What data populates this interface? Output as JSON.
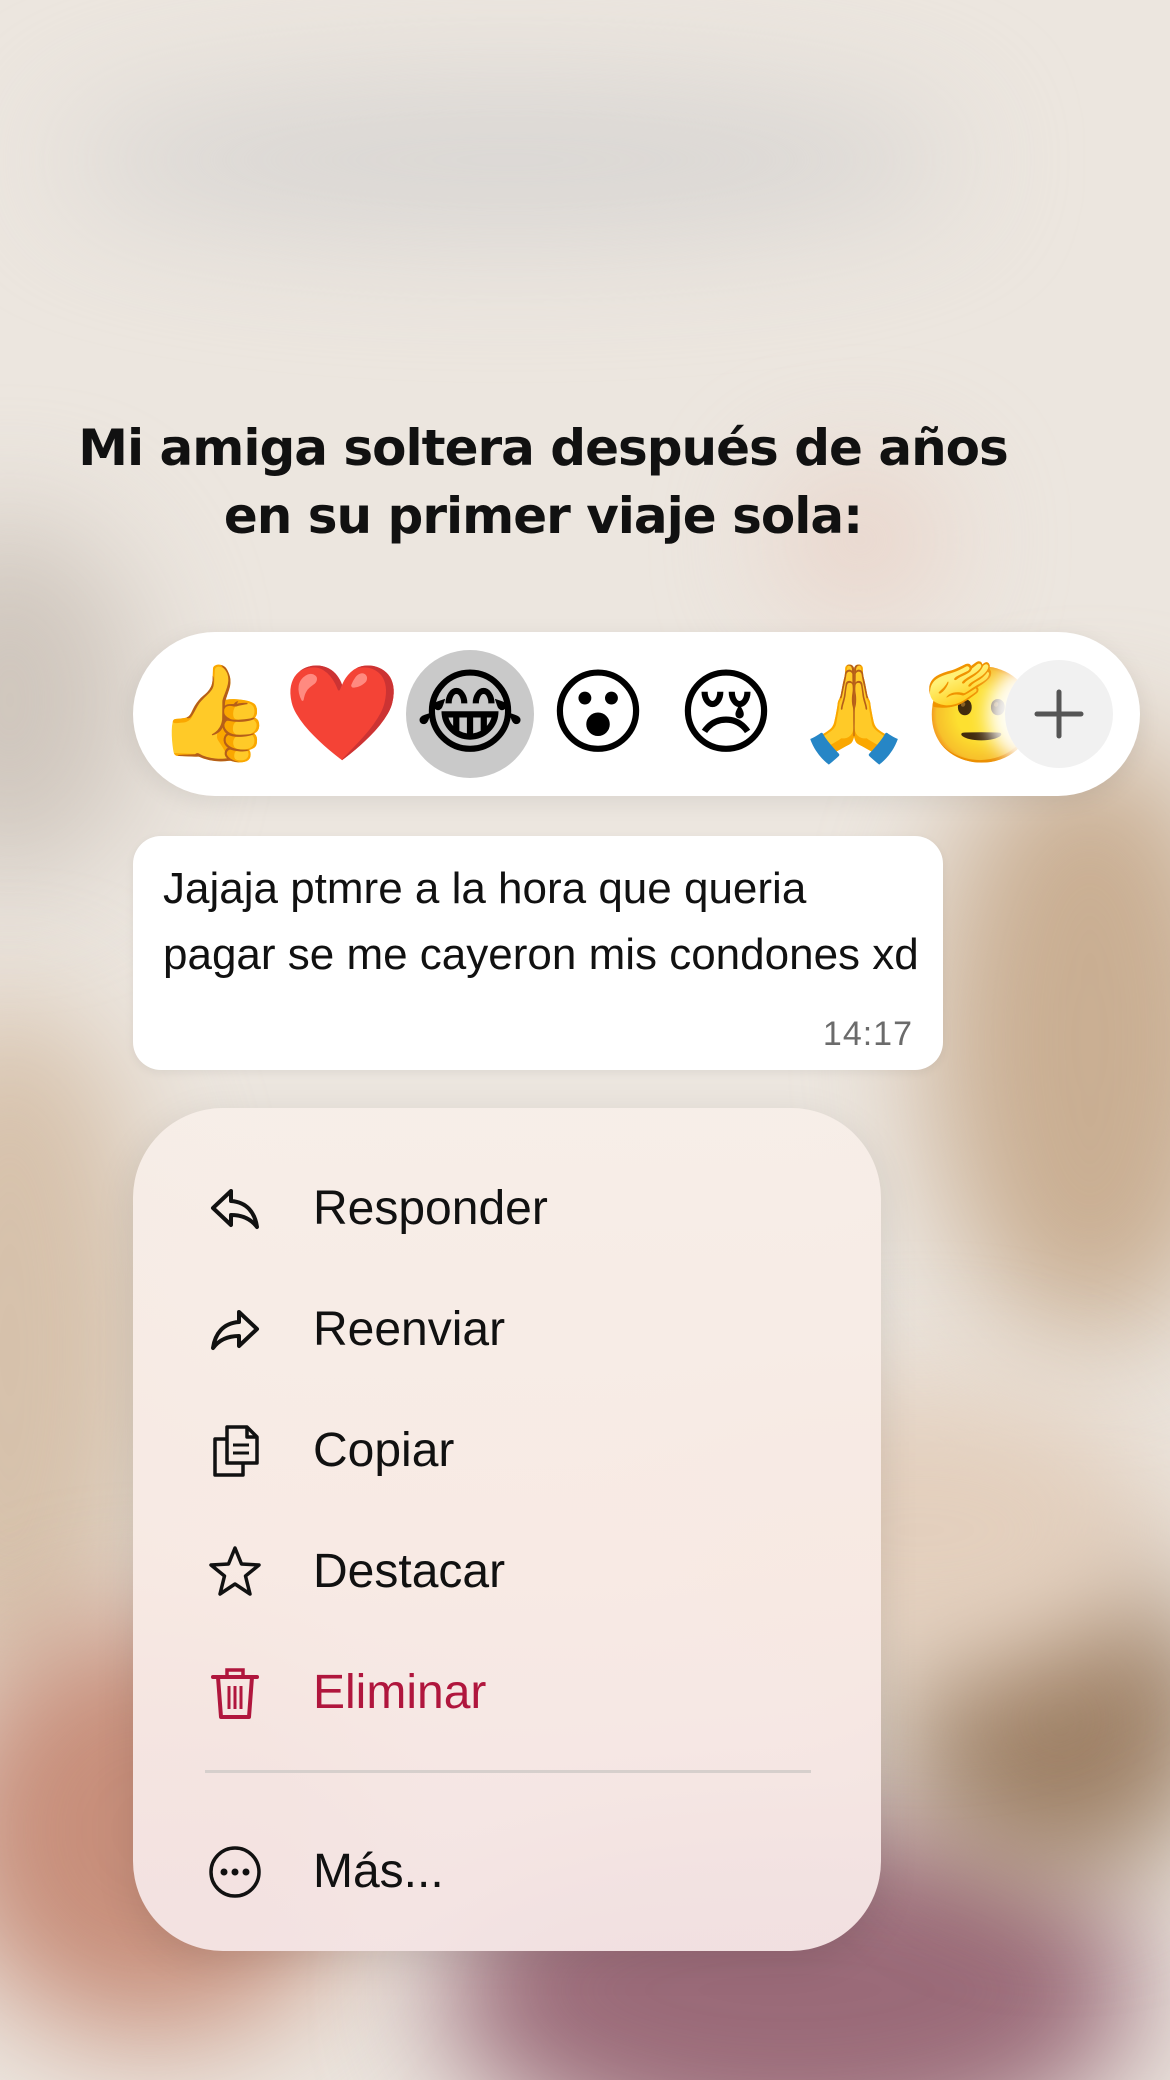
{
  "caption": {
    "line1": "Mi amiga soltera después de años",
    "line2": "en su primer viaje sola:"
  },
  "reactions": {
    "items": [
      {
        "emoji": "👍",
        "name": "thumbs-up"
      },
      {
        "emoji": "❤️",
        "name": "red-heart"
      },
      {
        "emoji": "😂",
        "name": "tears-of-joy",
        "selected": true
      },
      {
        "emoji": "😮",
        "name": "open-mouth"
      },
      {
        "emoji": "😢",
        "name": "crying-face"
      },
      {
        "emoji": "🙏",
        "name": "folded-hands"
      },
      {
        "emoji": "🫡",
        "name": "saluting-face"
      }
    ],
    "more_icon": "plus-icon"
  },
  "message": {
    "text": "Jajaja ptmre a la hora que queria pagar se me cayeron mis condones xd",
    "time": "14:17"
  },
  "menu": {
    "items": [
      {
        "label": "Responder",
        "icon": "reply-icon"
      },
      {
        "label": "Reenviar",
        "icon": "forward-icon"
      },
      {
        "label": "Copiar",
        "icon": "copy-icon"
      },
      {
        "label": "Destacar",
        "icon": "star-icon"
      },
      {
        "label": "Eliminar",
        "icon": "trash-icon",
        "color": "#b0163d"
      }
    ],
    "more": {
      "label": "Más...",
      "icon": "more-icon"
    }
  }
}
